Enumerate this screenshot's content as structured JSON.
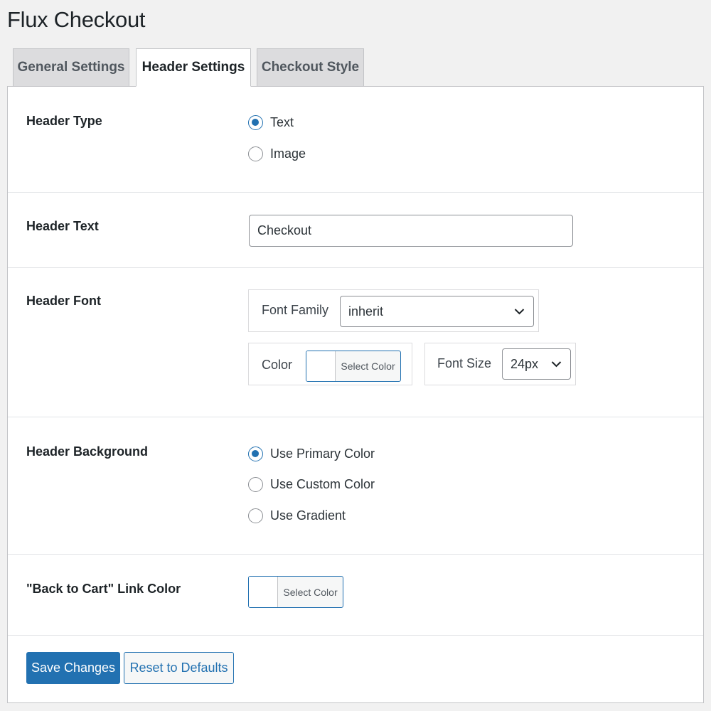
{
  "page": {
    "title": "Flux Checkout"
  },
  "tabs": [
    {
      "label": "General Settings",
      "active": false
    },
    {
      "label": "Header Settings",
      "active": true
    },
    {
      "label": "Checkout Style",
      "active": false
    }
  ],
  "header_type": {
    "label": "Header Type",
    "options": [
      {
        "label": "Text",
        "checked": true
      },
      {
        "label": "Image",
        "checked": false
      }
    ]
  },
  "header_text": {
    "label": "Header Text",
    "value": "Checkout"
  },
  "header_font": {
    "label": "Header Font",
    "font_family_label": "Font Family",
    "font_family_value": "inherit",
    "color_label": "Color",
    "color_button": "Select Color",
    "font_size_label": "Font Size",
    "font_size_value": "24px"
  },
  "header_background": {
    "label": "Header Background",
    "options": [
      {
        "label": "Use Primary Color",
        "checked": true
      },
      {
        "label": "Use Custom Color",
        "checked": false
      },
      {
        "label": "Use Gradient",
        "checked": false
      }
    ]
  },
  "back_to_cart": {
    "label": "\"Back to Cart\" Link Color",
    "color_button": "Select Color"
  },
  "actions": {
    "save": "Save Changes",
    "reset": "Reset to Defaults"
  },
  "colors": {
    "accent": "#2271b1",
    "page_bg": "#f1f1f1",
    "tab_inactive_bg": "#dcdcde"
  }
}
